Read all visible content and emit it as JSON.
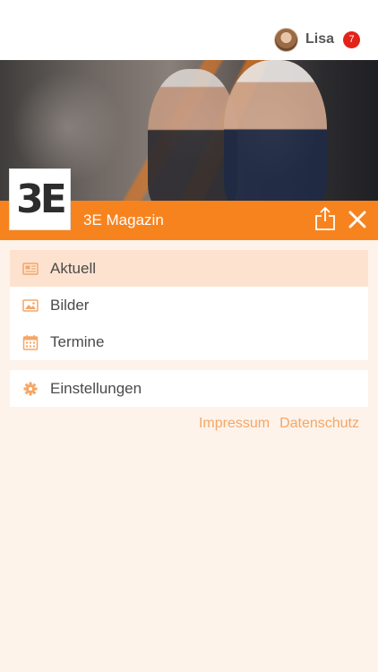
{
  "header": {
    "user_name": "Lisa",
    "notification_count": "7"
  },
  "logo": {
    "text": "3E"
  },
  "title_bar": {
    "title": "3E Magazin",
    "accent_color": "#f7831f"
  },
  "menu": {
    "items": [
      {
        "label": "Aktuell",
        "icon": "newspaper-icon",
        "active": true
      },
      {
        "label": "Bilder",
        "icon": "image-icon",
        "active": false
      },
      {
        "label": "Termine",
        "icon": "calendar-icon",
        "active": false
      }
    ]
  },
  "settings": {
    "label": "Einstellungen",
    "icon": "gear-icon"
  },
  "footer": {
    "impressum": "Impressum",
    "datenschutz": "Datenschutz"
  }
}
